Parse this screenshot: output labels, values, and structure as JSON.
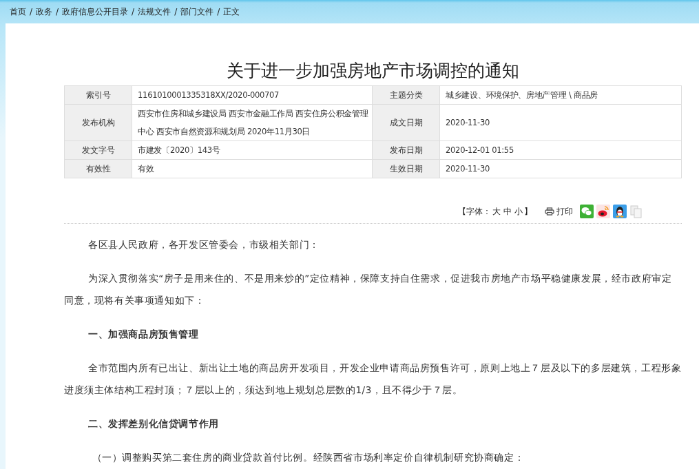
{
  "breadcrumb": {
    "items": [
      {
        "label": "首页"
      },
      {
        "label": "政务"
      },
      {
        "label": "政府信息公开目录"
      },
      {
        "label": "法规文件"
      },
      {
        "label": "部门文件"
      },
      {
        "label": "正文"
      }
    ],
    "separators": [
      "/",
      "/",
      "/",
      "/",
      "/"
    ]
  },
  "title": "关于进一步加强房地产市场调控的通知",
  "meta": [
    {
      "label": "索引号",
      "value": "1161010001335318XX/2020-000707",
      "label_2": "主题分类",
      "value_2": "城乡建设、环境保护、房地产管理 \\ 商品房"
    },
    {
      "label": "发布机构",
      "value": "西安市住房和城乡建设局 西安市金融工作局 西安住房公积金管理中心 西安市自然资源和规划局 2020年11月30日",
      "label_2": "成文日期",
      "value_2": "2020-11-30"
    },
    {
      "label": "发文字号",
      "value": "市建发〔2020〕143号",
      "label_2": "发布日期",
      "value_2": "2020-12-01 01:55"
    },
    {
      "label": "有效性",
      "value": "有效",
      "label_2": "生效日期",
      "value_2": "2020-11-30"
    }
  ],
  "tools": {
    "font_prefix": "【字体：",
    "font_sizes": [
      "大",
      "中",
      "小"
    ],
    "font_suffix": "】",
    "print": "打印"
  },
  "body": [
    {
      "kind": "para",
      "text": "各区县人民政府，各开发区管委会，市级相关部门："
    },
    {
      "kind": "para",
      "text": "为深入贯彻落实“房子是用来住的、不是用来炒的”定位精神，保障支持自住需求，促进我市房地产市场平稳健康发展，经市政府审定同意，现将有关事项通知如下："
    },
    {
      "kind": "heading",
      "text": "一、加强商品房预售管理"
    },
    {
      "kind": "para",
      "text": "全市范围内所有已出让、新出让土地的商品房开发项目，开发企业申请商品房预售许可，原则上地上７层及以下的多层建筑，工程形象进度须主体结构工程封顶；７层以上的，须达到地上规划总层数的1/3，且不得少于７层。"
    },
    {
      "kind": "heading",
      "text": "二、发挥差别化信贷调节作用"
    },
    {
      "kind": "sub",
      "text": "（一）调整购买第二套住房的商业贷款首付比例。经陕西省市场利率定价自律机制研究协商确定："
    }
  ]
}
